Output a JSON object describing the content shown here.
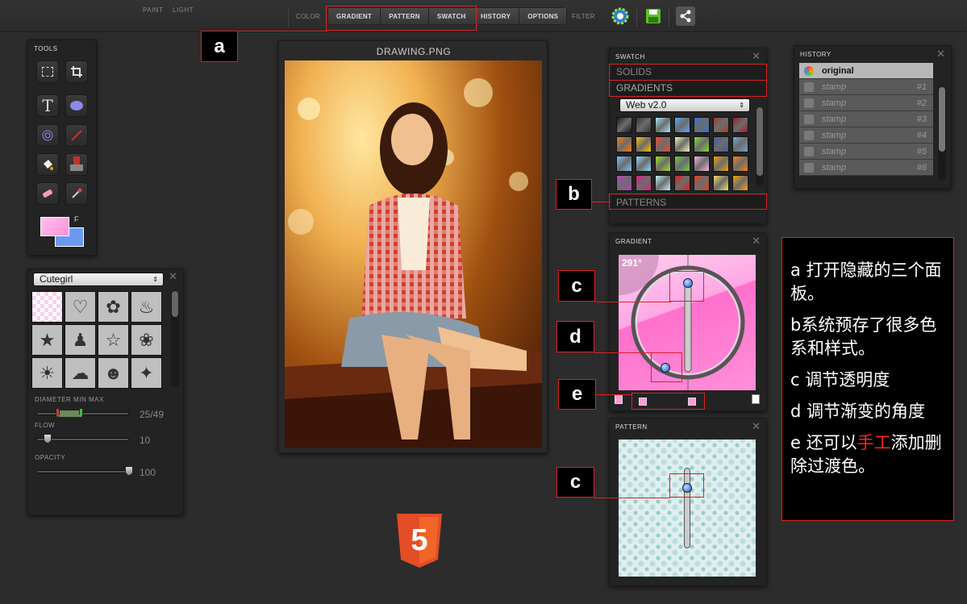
{
  "topbar": {
    "paint": "PAINT",
    "light": "LIGHT",
    "color": "COLOR",
    "buttons": [
      "GRADIENT",
      "PATTERN",
      "SWATCH",
      "HISTORY",
      "OPTIONS"
    ],
    "filter": "FILTER",
    "icons": [
      "settings-gear-icon",
      "save-disk-icon",
      "share-icon"
    ]
  },
  "tools": {
    "title": "TOOLS",
    "items": [
      "marquee",
      "crop",
      "text",
      "ellipse",
      "spirograph",
      "brush",
      "fill",
      "stamp",
      "eraser",
      "eyedropper"
    ],
    "color_swap_label": "F"
  },
  "brushes": {
    "preset": "Cutegirl",
    "diameter_label": "DIAMETER MIN MAX",
    "diameter_min": 25,
    "diameter_max": 49,
    "diameter_value": "25/49",
    "flow_label": "FLOW",
    "flow_value": "10",
    "opacity_label": "OPACITY",
    "opacity_value": "100"
  },
  "canvas": {
    "title": "DRAWING.PNG"
  },
  "swatch": {
    "title": "SWATCH",
    "solids": "SOLIDS",
    "gradients": "GRADIENTS",
    "select": "Web v2.0",
    "patterns": "PATTERNS",
    "colors": [
      "#1a1a1a",
      "#333",
      "#9ee6ff",
      "#5aa8ff",
      "#3b6fd0",
      "#a0402a",
      "#9e1a2a",
      "#ff7a00",
      "#ffc000",
      "#f24a2a",
      "#eef9b0",
      "#7fdc2a",
      "#4a5a9a",
      "#6aa8d0",
      "#7ec0ff",
      "#8ad8ff",
      "#a0e020",
      "#6ad040",
      "#ffb0e0",
      "#f0a000",
      "#ff8000",
      "#c040c0",
      "#e02080",
      "#c0f0ff",
      "#e02020",
      "#e04020",
      "#f0e060",
      "#ffa000"
    ]
  },
  "history": {
    "title": "HISTORY",
    "rows": [
      {
        "label": "original",
        "num": ""
      },
      {
        "label": "stamp",
        "num": "#1"
      },
      {
        "label": "stamp",
        "num": "#2"
      },
      {
        "label": "stamp",
        "num": "#3"
      },
      {
        "label": "stamp",
        "num": "#4"
      },
      {
        "label": "stamp",
        "num": "#5"
      },
      {
        "label": "stamp",
        "num": "#6"
      }
    ]
  },
  "gradient": {
    "title": "GRADIENT",
    "angle": "291°"
  },
  "pattern": {
    "title": "PATTERN"
  },
  "annotations": {
    "a": "a",
    "b": "b",
    "c1": "c",
    "d": "d",
    "e": "e",
    "c2": "c",
    "notes": [
      {
        "parts": [
          {
            "t": "a 打开隐藏的三个面板。",
            "red": false
          }
        ]
      },
      {
        "parts": [
          {
            "t": "b系统预存了很多色系和样式。",
            "red": false
          }
        ]
      },
      {
        "parts": [
          {
            "t": "c 调节透明度",
            "red": false
          }
        ]
      },
      {
        "parts": [
          {
            "t": "d 调节渐变的角度",
            "red": false
          }
        ]
      },
      {
        "parts": [
          {
            "t": "e 还可以",
            "red": false
          },
          {
            "t": "手工",
            "red": true
          },
          {
            "t": "添加删除过渡色。",
            "red": false
          }
        ]
      }
    ]
  },
  "logo": "5"
}
